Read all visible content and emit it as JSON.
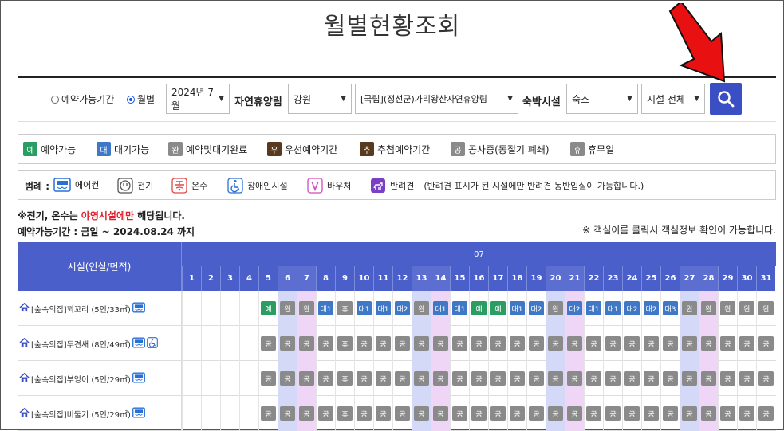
{
  "page": {
    "title": "월별현황조회"
  },
  "search": {
    "radio_period": "예약가능기간",
    "radio_monthly": "월별",
    "month_select": "2024년 7월",
    "forest_label": "자연휴양림",
    "region_select": "강원",
    "forest_select": "[국립](정선군)가리왕산자연휴양림",
    "facility_label": "숙박시설",
    "facility_type_select": "숙소",
    "facility_all_select": "시설 전체",
    "icon": "search-icon"
  },
  "status_legend": [
    {
      "chip": "예",
      "label": "예약가능",
      "color": "#2a9d63"
    },
    {
      "chip": "대",
      "label": "대기가능",
      "color": "#3f78c6"
    },
    {
      "chip": "완",
      "label": "예약및대기완료",
      "color": "#8a8a8a"
    },
    {
      "chip": "우",
      "label": "우선예약기간",
      "color": "#5a3a1e"
    },
    {
      "chip": "추",
      "label": "추첨예약기간",
      "color": "#5a3a1e"
    },
    {
      "chip": "공",
      "label": "공사중(동절기 폐쇄)",
      "color": "#8a8a8a"
    },
    {
      "chip": "휴",
      "label": "휴무일",
      "color": "#8a8a8a"
    }
  ],
  "icon_legend": {
    "title": "범례 :",
    "items": [
      {
        "icon": "air-conditioner-icon",
        "label": "에어컨"
      },
      {
        "icon": "electricity-icon",
        "label": "전기"
      },
      {
        "icon": "hot-water-icon",
        "label": "온수"
      },
      {
        "icon": "wheelchair-icon",
        "label": "장애인시설"
      },
      {
        "icon": "voucher-icon",
        "label": "바우처"
      },
      {
        "icon": "pet-icon",
        "label": "반려견"
      }
    ],
    "pet_note": "(반려견 표시가 된 시설에만 반려견 동반입실이 가능합니다.)"
  },
  "notes": {
    "electric_prefix": "※전기, 온수는 ",
    "electric_highlight": "야영시설에만",
    "electric_suffix": " 해당됩니다.",
    "period": "예약가능기간 : 금일 ~ 2024.08.24 까지",
    "room_info": "※ 객실이름 클릭시 객실정보 확인이 가능합니다."
  },
  "table": {
    "facility_header": "시설(인실/면적)",
    "month_header": "07",
    "days": [
      "1",
      "2",
      "3",
      "4",
      "5",
      "6",
      "7",
      "8",
      "9",
      "10",
      "11",
      "12",
      "13",
      "14",
      "15",
      "16",
      "17",
      "18",
      "19",
      "20",
      "21",
      "22",
      "23",
      "24",
      "25",
      "26",
      "27",
      "28",
      "29",
      "30",
      "31"
    ],
    "saturday_days": [
      6,
      13,
      20,
      27
    ],
    "sunday_days": [
      7,
      14,
      21,
      28
    ],
    "colors": {
      "예": "#2a9d63",
      "대1": "#3f78c6",
      "대2": "#3f78c6",
      "대3": "#3f78c6",
      "완": "#8a8a8a",
      "공": "#8a8a8a",
      "휴": "#8a8a8a"
    },
    "rows": [
      {
        "name": "[숲속의집]꾀꼬리 (5인/33㎡)",
        "icons": [
          "air-conditioner-icon"
        ],
        "cells": [
          "",
          "",
          "",
          "",
          "예",
          "완",
          "완",
          "대1",
          "휴",
          "대1",
          "대1",
          "대2",
          "완",
          "대1",
          "대1",
          "예",
          "예",
          "대1",
          "대2",
          "완",
          "대2",
          "대1",
          "대1",
          "대2",
          "대2",
          "대3",
          "완",
          "완",
          "완",
          "완",
          "완"
        ]
      },
      {
        "name": "[숲속의집]두견새 (8인/49㎡)",
        "icons": [
          "air-conditioner-icon",
          "wheelchair-icon"
        ],
        "cells": [
          "",
          "",
          "",
          "",
          "공",
          "공",
          "공",
          "공",
          "휴",
          "공",
          "공",
          "공",
          "공",
          "공",
          "공",
          "공",
          "공",
          "공",
          "공",
          "공",
          "공",
          "공",
          "공",
          "공",
          "공",
          "공",
          "공",
          "공",
          "공",
          "공",
          "공"
        ]
      },
      {
        "name": "[숲속의집]부엉이 (5인/29㎡)",
        "icons": [
          "air-conditioner-icon"
        ],
        "cells": [
          "",
          "",
          "",
          "",
          "공",
          "공",
          "공",
          "공",
          "휴",
          "공",
          "공",
          "공",
          "공",
          "공",
          "공",
          "공",
          "공",
          "공",
          "공",
          "공",
          "공",
          "공",
          "공",
          "공",
          "공",
          "공",
          "공",
          "공",
          "공",
          "공",
          "공"
        ]
      },
      {
        "name": "[숲속의집]비둘기 (5인/29㎡)",
        "icons": [
          "air-conditioner-icon"
        ],
        "cells": [
          "",
          "",
          "",
          "",
          "공",
          "공",
          "공",
          "공",
          "휴",
          "공",
          "공",
          "공",
          "공",
          "공",
          "공",
          "공",
          "공",
          "공",
          "공",
          "공",
          "공",
          "공",
          "공",
          "공",
          "공",
          "공",
          "공",
          "공",
          "공",
          "공",
          "공"
        ]
      }
    ]
  },
  "annotation": {
    "icon": "red-arrow-icon",
    "color": "#e81010"
  }
}
